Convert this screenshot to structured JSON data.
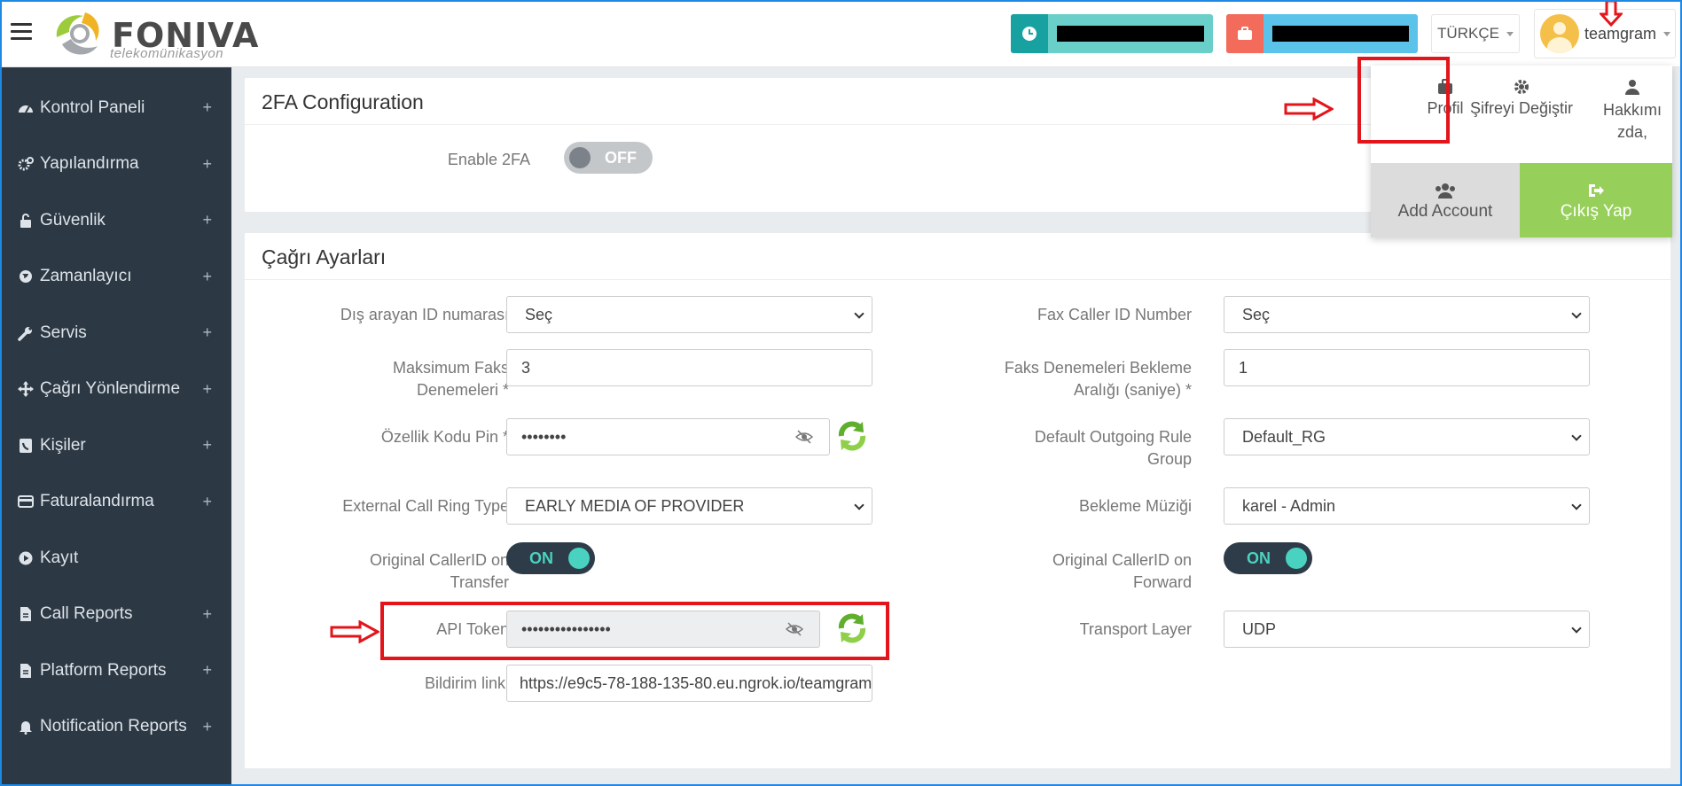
{
  "header": {
    "logo_name": "FONIVA",
    "logo_sub": "telekomünikasyon",
    "language": "TÜRKÇE",
    "username": "teamgram"
  },
  "user_menu": {
    "profile": "Profil",
    "change_password": "Şifreyi Değiştir",
    "about_line1": "Hakkımı",
    "about_line2": "zda,",
    "add_account": "Add Account",
    "logout": "Çıkış Yap"
  },
  "sidebar": {
    "items": [
      {
        "label": "Kontrol Paneli",
        "icon": "dashboard-icon",
        "expandable": true
      },
      {
        "label": "Yapılandırma",
        "icon": "gears-icon",
        "expandable": true
      },
      {
        "label": "Güvenlik",
        "icon": "lock-open-icon",
        "expandable": true
      },
      {
        "label": "Zamanlayıcı",
        "icon": "globe-icon",
        "expandable": true
      },
      {
        "label": "Servis",
        "icon": "wrench-icon",
        "expandable": true
      },
      {
        "label": "Çağrı Yönlendirme",
        "icon": "arrows-move-icon",
        "expandable": true
      },
      {
        "label": "Kişiler",
        "icon": "contact-book-icon",
        "expandable": true
      },
      {
        "label": "Faturalandırma",
        "icon": "credit-card-icon",
        "expandable": true
      },
      {
        "label": "Kayıt",
        "icon": "play-circle-icon",
        "expandable": false
      },
      {
        "label": "Call Reports",
        "icon": "file-icon",
        "expandable": true
      },
      {
        "label": "Platform Reports",
        "icon": "file-icon",
        "expandable": true
      },
      {
        "label": "Notification Reports",
        "icon": "bell-icon",
        "expandable": true
      }
    ]
  },
  "twofa": {
    "title": "2FA Configuration",
    "enable_label": "Enable 2FA",
    "toggle_text": "OFF"
  },
  "call_settings": {
    "title": "Çağrı Ayarları",
    "outgoing_caller_id": {
      "label": "Dış arayan ID numarası",
      "value": "Seç"
    },
    "fax_caller_id": {
      "label": "Fax Caller ID Number",
      "value": "Seç"
    },
    "max_fax_attempts": {
      "label_line1": "Maksimum Faks",
      "label_line2": "Denemeleri *",
      "value": "3"
    },
    "fax_retry_interval": {
      "label_line1": "Faks Denemeleri Bekleme",
      "label_line2": "Aralığı (saniye) *",
      "value": "1"
    },
    "feature_code_pin": {
      "label": "Özellik Kodu Pin *",
      "value": "••••••••"
    },
    "default_outgoing_rule": {
      "label_line1": "Default Outgoing Rule",
      "label_line2": "Group",
      "value": "Default_RG"
    },
    "external_ring_type": {
      "label": "External Call Ring Type",
      "value": "EARLY MEDIA OF PROVIDER"
    },
    "music_on_hold": {
      "label": "Bekleme Müziği",
      "value": "karel - Admin"
    },
    "orig_callerid_transfer": {
      "label_line1": "Original CallerID on",
      "label_line2": "Transfer",
      "toggle_text": "ON"
    },
    "orig_callerid_forward": {
      "label_line1": "Original CallerID on",
      "label_line2": "Forward",
      "toggle_text": "ON"
    },
    "api_token": {
      "label": "API Token",
      "value": "••••••••••••••••"
    },
    "transport_layer": {
      "label": "Transport Layer",
      "value": "UDP"
    },
    "notification_link": {
      "label": "Bildirim linki",
      "value": "https://e9c5-78-188-135-80.eu.ngrok.io/teamgram"
    }
  },
  "colors": {
    "sidebar_bg": "#2c3844",
    "accent_teal": "#4ad2c0",
    "logout_green": "#96cf5a",
    "annotation_red": "#e3141a"
  }
}
